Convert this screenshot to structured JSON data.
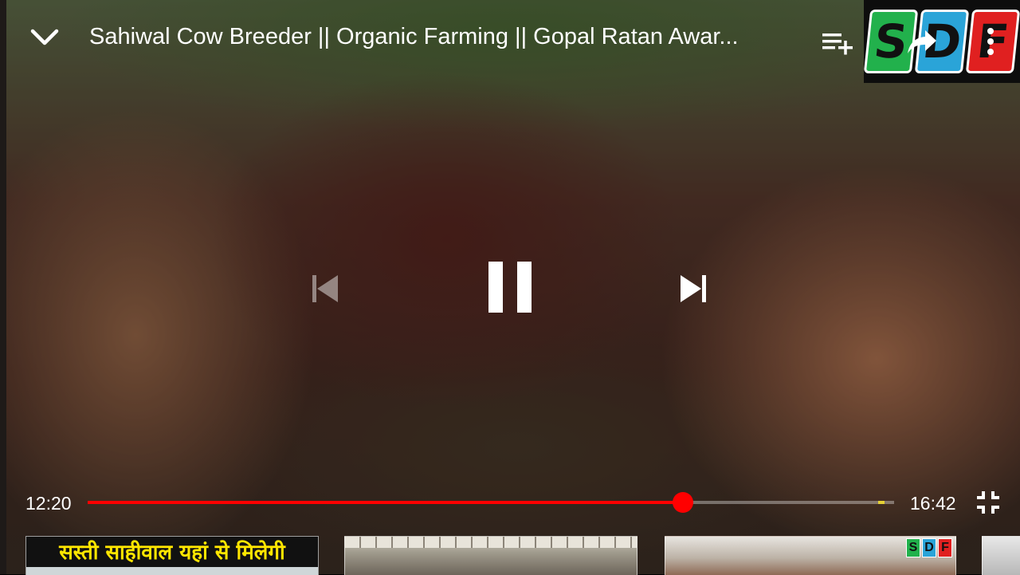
{
  "player": {
    "title": "Sahiwal Cow Breeder || Organic Farming || Gopal Ratan Awar...",
    "current_time": "12:20",
    "duration": "16:42",
    "progress_fraction": 0.7381,
    "buffered_fraction": 0.9924,
    "accent_color": "#ff0000"
  },
  "top_bar": {
    "icons": [
      "chevron-down-icon",
      "add-to-queue-icon",
      "share-icon",
      "more-vert-icon"
    ]
  },
  "watermark": {
    "letters": [
      "S",
      "D",
      "F"
    ],
    "colors": [
      "#22b14c",
      "#2aa4d8",
      "#e02020"
    ]
  },
  "controls": {
    "icons": [
      "skip-previous-icon",
      "pause-icon",
      "skip-next-icon",
      "fullscreen-exit-icon"
    ]
  },
  "related": [
    {
      "caption": "सस्ती साहीवाल यहां से मिलेगी"
    },
    {
      "caption": ""
    },
    {
      "logo_letters": [
        "S",
        "D",
        "F"
      ]
    },
    {
      "caption": ""
    }
  ]
}
